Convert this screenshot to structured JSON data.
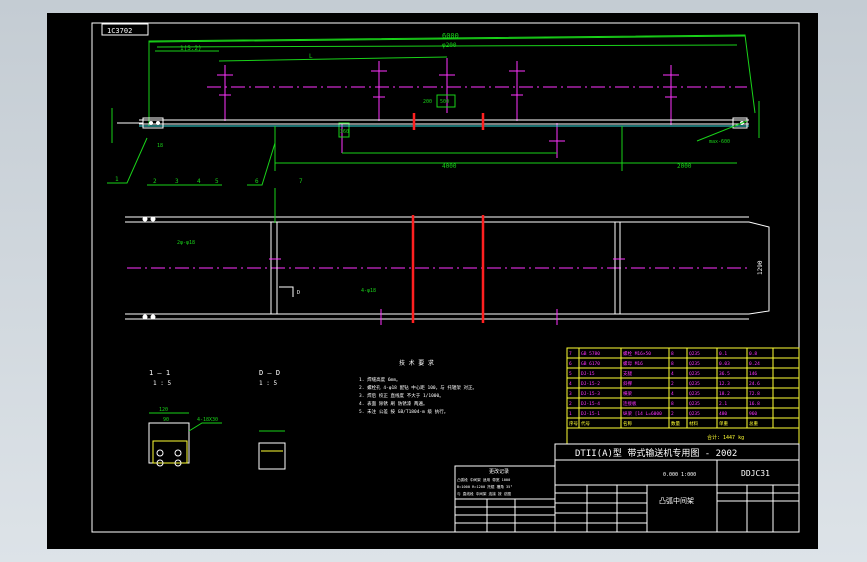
{
  "drawing": {
    "code_box": "1C3702",
    "title_main": "DTII(A)型 带式输送机专用图 - 2002",
    "part_name": "凸弧中间架",
    "drawing_no": "DDJC31",
    "weight_label": "0.000 1:000",
    "total_weight_label": "合计: 1447 kg"
  },
  "views": {
    "section_1_label": "1 — 1",
    "section_1_sub": "1 : 5",
    "section_d_label": "D — D",
    "section_d_sub": "1 : 5",
    "item_numbers": [
      "1",
      "2",
      "3",
      "4",
      "5",
      "6",
      "7"
    ]
  },
  "dims": {
    "top_overall": "6000",
    "top_inner": "φ200",
    "left_offset": "1(5.2)",
    "mid_a": "L",
    "mid_b": "500",
    "side_h": "360",
    "side_h2": "200",
    "right_note": "max-600",
    "right_h": "18",
    "bottom_left": "4000",
    "bottom_right": "2000",
    "plan_height": "1290",
    "plan_label_1": "2φ-φ18",
    "plan_label_2": "4-φ18",
    "plan_label_d": "D",
    "section_w": "120",
    "section_w2": "90",
    "section_note": "4-18X30"
  },
  "notes": {
    "heading": "技 术 要 求",
    "lines": [
      "1. 焊缝高度 6mm。",
      "2. 螺栓孔 4-φ18 配钻 中心距 100，与 托辊架 对正。",
      "3. 焊后 校正 直线度 不大于 1/1000。",
      "4. 表面 除锈 刷 防锈漆 两遍。",
      "5. 未注 公差 按 GB/T1804-m 级 执行。"
    ]
  },
  "change_table": {
    "title": "更改记录",
    "lines": [
      "凸弧段 中间架 适用 带宽 1000",
      "B=1000 R=1200 托辊 槽角 35°",
      "与 直线段 中间架 连接 按 总图"
    ]
  },
  "bom": {
    "rows": [
      [
        "7",
        "GB 5780",
        "螺栓 M16×50",
        "8",
        "Q235",
        "0.1",
        "0.8"
      ],
      [
        "6",
        "GB 6170",
        "螺母 M16",
        "8",
        "Q235",
        "0.03",
        "0.24"
      ],
      [
        "5",
        "DJ-15",
        "支腿",
        "4",
        "Q235",
        "36.5",
        "146"
      ],
      [
        "4",
        "DJ-15-2",
        "斜撑",
        "2",
        "Q235",
        "12.3",
        "24.6"
      ],
      [
        "3",
        "DJ-15-3",
        "横梁",
        "4",
        "Q235",
        "18.2",
        "72.8"
      ],
      [
        "2",
        "DJ-15-4",
        "连接板",
        "8",
        "Q235",
        "2.1",
        "16.8"
      ],
      [
        "1",
        "DJ-15-1",
        "纵梁 [14 L=6000",
        "2",
        "Q235",
        "480",
        "960"
      ]
    ],
    "header": [
      "序号",
      "代号",
      "名称",
      "数量",
      "材料",
      "单重",
      "总重"
    ]
  },
  "colors": {
    "white": "#ffffff",
    "green": "#19d219",
    "magenta": "#ff33ff",
    "red": "#ff2020",
    "yellow": "#ffff33"
  }
}
